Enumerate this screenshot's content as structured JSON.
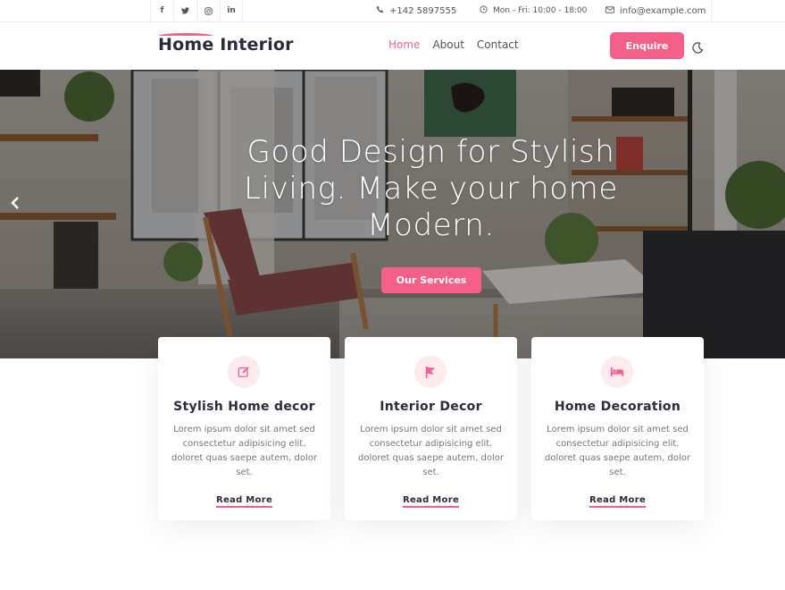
{
  "topbar": {
    "socials": [
      {
        "icon": "facebook-icon",
        "glyph": "f"
      },
      {
        "icon": "twitter-icon",
        "glyph": "🐦"
      },
      {
        "icon": "instagram-icon",
        "glyph": "◎"
      },
      {
        "icon": "linkedin-icon",
        "glyph": "in"
      }
    ],
    "phone": "+142 5897555",
    "hours": "Mon - Fri: 10:00 - 18:00",
    "email": "info@example.com"
  },
  "header": {
    "logo": "Home Interior",
    "nav": [
      {
        "label": "Home",
        "active": true
      },
      {
        "label": "About",
        "active": false
      },
      {
        "label": "Contact",
        "active": false
      }
    ],
    "enquire": "Enquire",
    "theme_icon": "moon-icon"
  },
  "hero": {
    "title": "Good Design for Stylish Living. Make your home Modern.",
    "button": "Our Services",
    "prev_icon": "chevron-left-icon"
  },
  "cards": [
    {
      "icon": "edit-icon",
      "title": "Stylish Home decor",
      "text": "Lorem ipsum dolor sit amet sed consectetur adipisicing elit. doloret quas saepe autem, dolor set.",
      "link": "Read More"
    },
    {
      "icon": "flag-icon",
      "title": "Interior Decor",
      "text": "Lorem ipsum dolor sit amet sed consectetur adipisicing elit. doloret quas saepe autem, dolor set.",
      "link": "Read More"
    },
    {
      "icon": "bed-icon",
      "title": "Home Decoration",
      "text": "Lorem ipsum dolor sit amet sed consectetur adipisicing elit. doloret quas saepe autem, dolor set.",
      "link": "Read More"
    }
  ],
  "colors": {
    "accent": "#f5608a",
    "heading": "#2b2b3a",
    "body_text": "#777777"
  }
}
